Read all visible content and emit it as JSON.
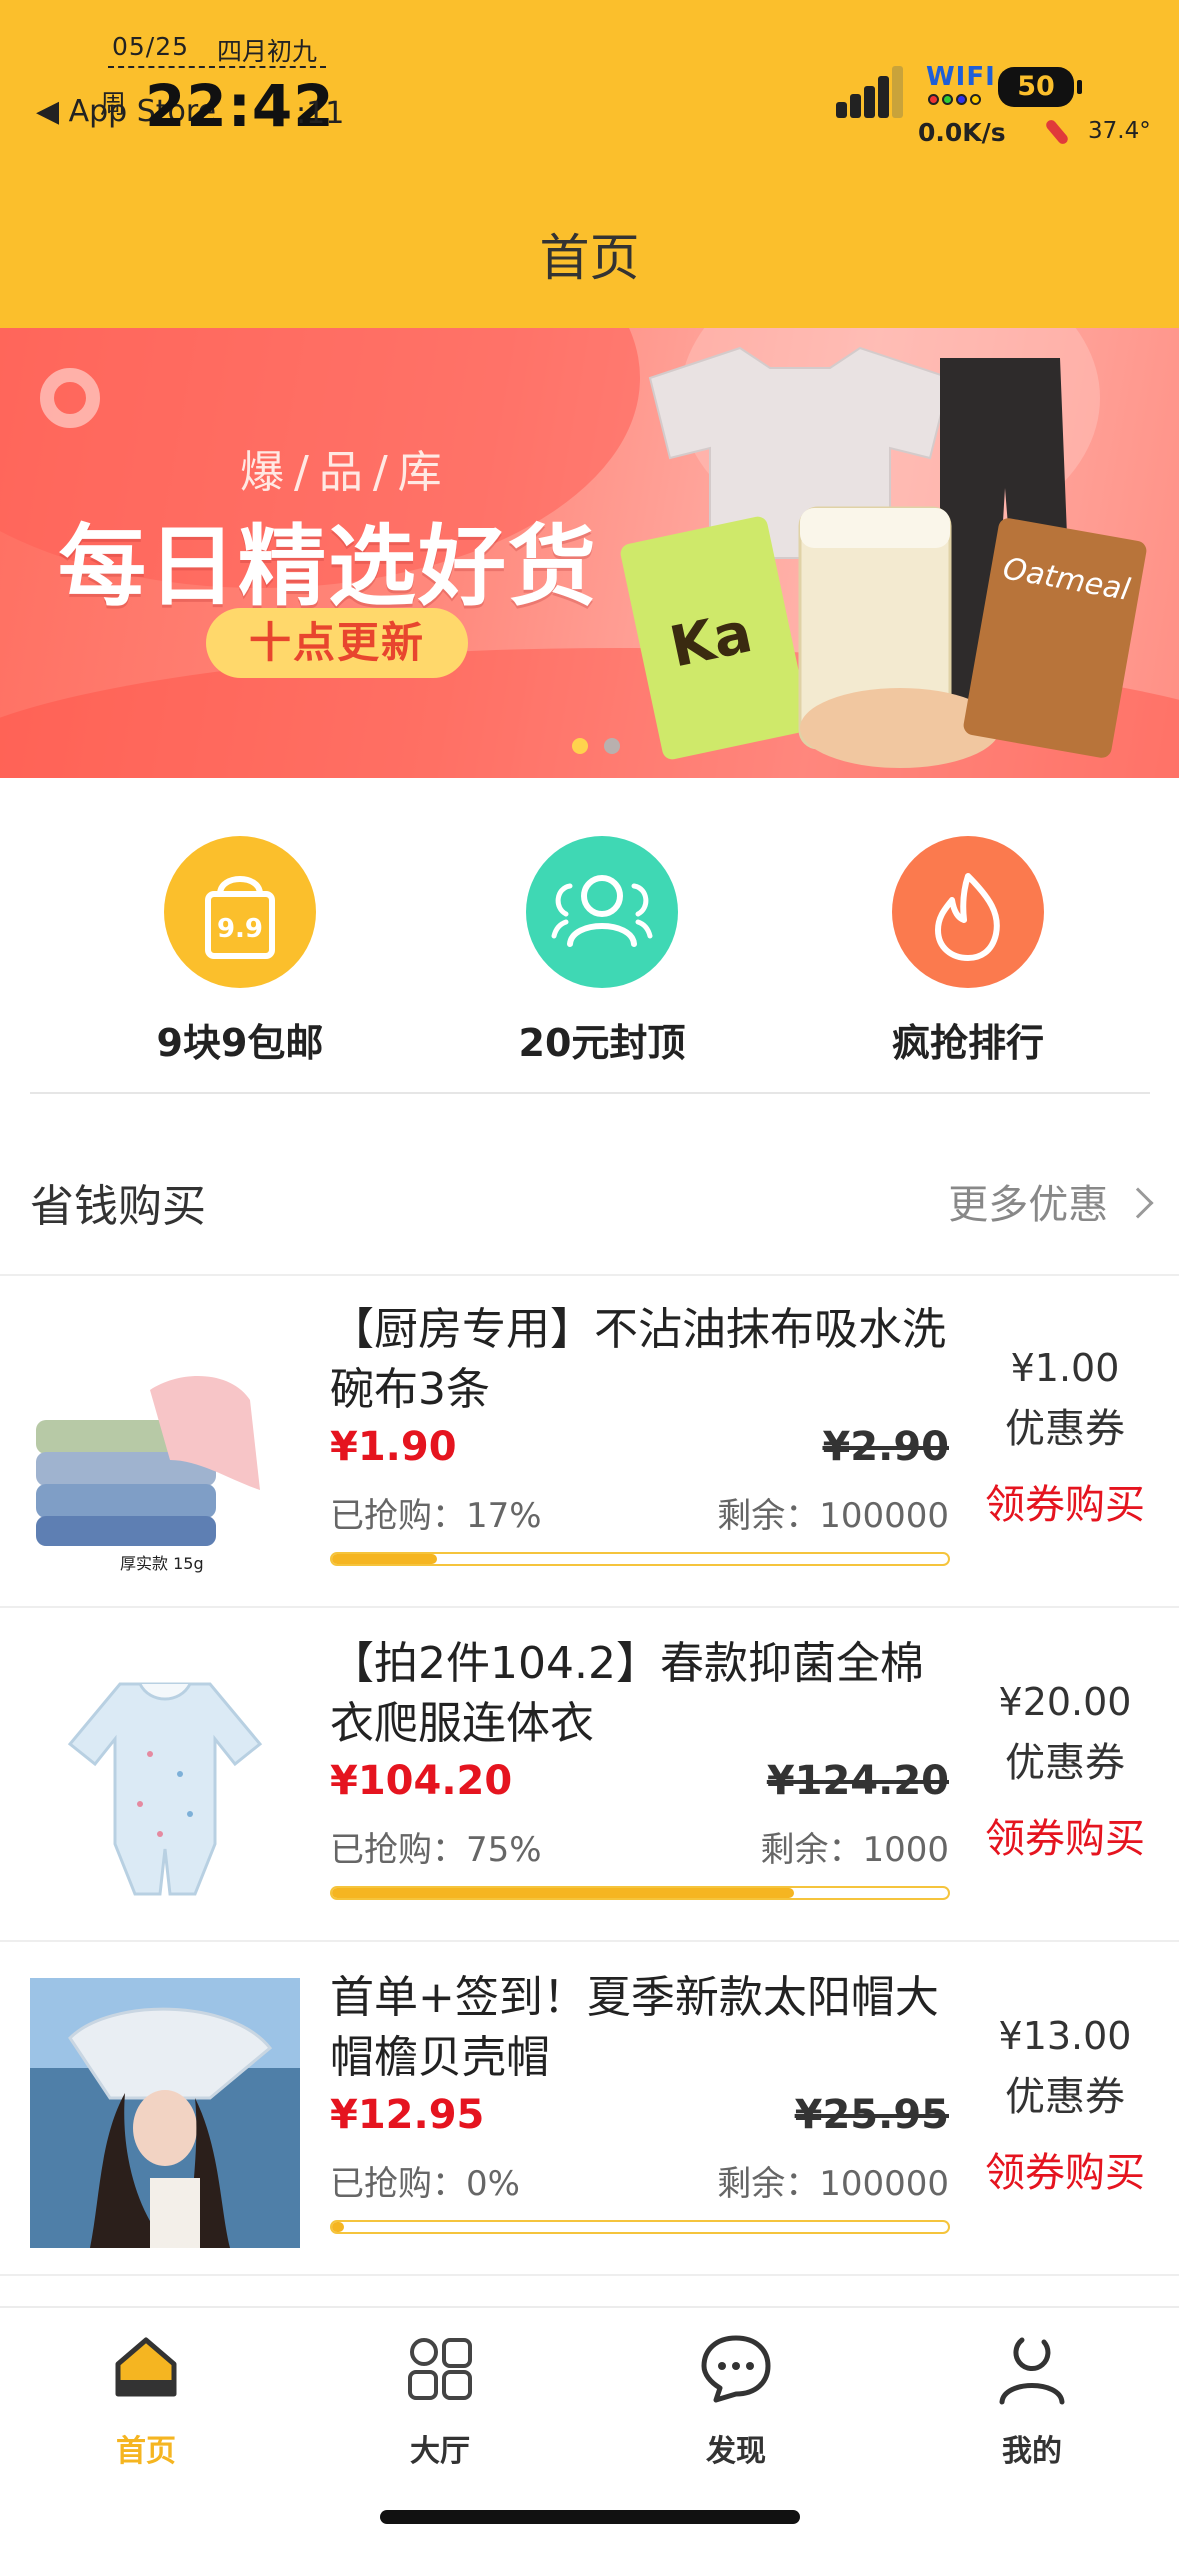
{
  "status_bar": {
    "date": "05/25",
    "lunar": "四月初九",
    "back_app": "◀ App Store",
    "weekday": "周",
    "time": "22:42",
    "seconds": ":11",
    "wifi_label": "WIFI",
    "speed": "0.0K/s",
    "battery": "50",
    "temperature": "37.4°"
  },
  "header": {
    "title": "首页"
  },
  "banner": {
    "subtitle": "爆/品/库",
    "headline": "每日精选好货",
    "pill": "十点更新",
    "page_count": 2,
    "active_page": 1
  },
  "categories": [
    {
      "label": "9块9包邮",
      "icon": "shopping-bag-9.9-icon",
      "color": "#fbbf2c",
      "badge": "9.9"
    },
    {
      "label": "20元封顶",
      "icon": "group-users-icon",
      "color": "#3fd8b4"
    },
    {
      "label": "疯抢排行",
      "icon": "flame-icon",
      "color": "#fb7a4e"
    }
  ],
  "section": {
    "title": "省钱购买",
    "more": "更多优惠"
  },
  "products": [
    {
      "title": "【厨房专用】不沾油抹布吸水洗碗布3条",
      "price": "¥1.90",
      "original_price": "¥2.90",
      "sold": "已抢购：17%",
      "remaining": "剩余：100000",
      "progress": 0.17,
      "coupon_value": "¥1.00",
      "coupon_label": "优惠券",
      "action": "领券购买",
      "thumb_caption": "厚实款 15g"
    },
    {
      "title": "【拍2件104.2】春款抑菌全棉衣爬服连体衣",
      "price": "¥104.20",
      "original_price": "¥124.20",
      "sold": "已抢购：75%",
      "remaining": "剩余：1000",
      "progress": 0.75,
      "coupon_value": "¥20.00",
      "coupon_label": "优惠券",
      "action": "领券购买"
    },
    {
      "title": "首单+签到！夏季新款太阳帽大帽檐贝壳帽",
      "price": "¥12.95",
      "original_price": "¥25.95",
      "sold": "已抢购：0%",
      "remaining": "剩余：100000",
      "progress": 0.02,
      "coupon_value": "¥13.00",
      "coupon_label": "优惠券",
      "action": "领券购买"
    }
  ],
  "tabbar": {
    "active_color": "#f5b521",
    "items": [
      {
        "label": "首页",
        "icon": "home-icon",
        "active": true
      },
      {
        "label": "大厅",
        "icon": "grid-icon",
        "active": false
      },
      {
        "label": "发现",
        "icon": "chat-bubble-icon",
        "active": false
      },
      {
        "label": "我的",
        "icon": "user-icon",
        "active": false
      }
    ]
  }
}
